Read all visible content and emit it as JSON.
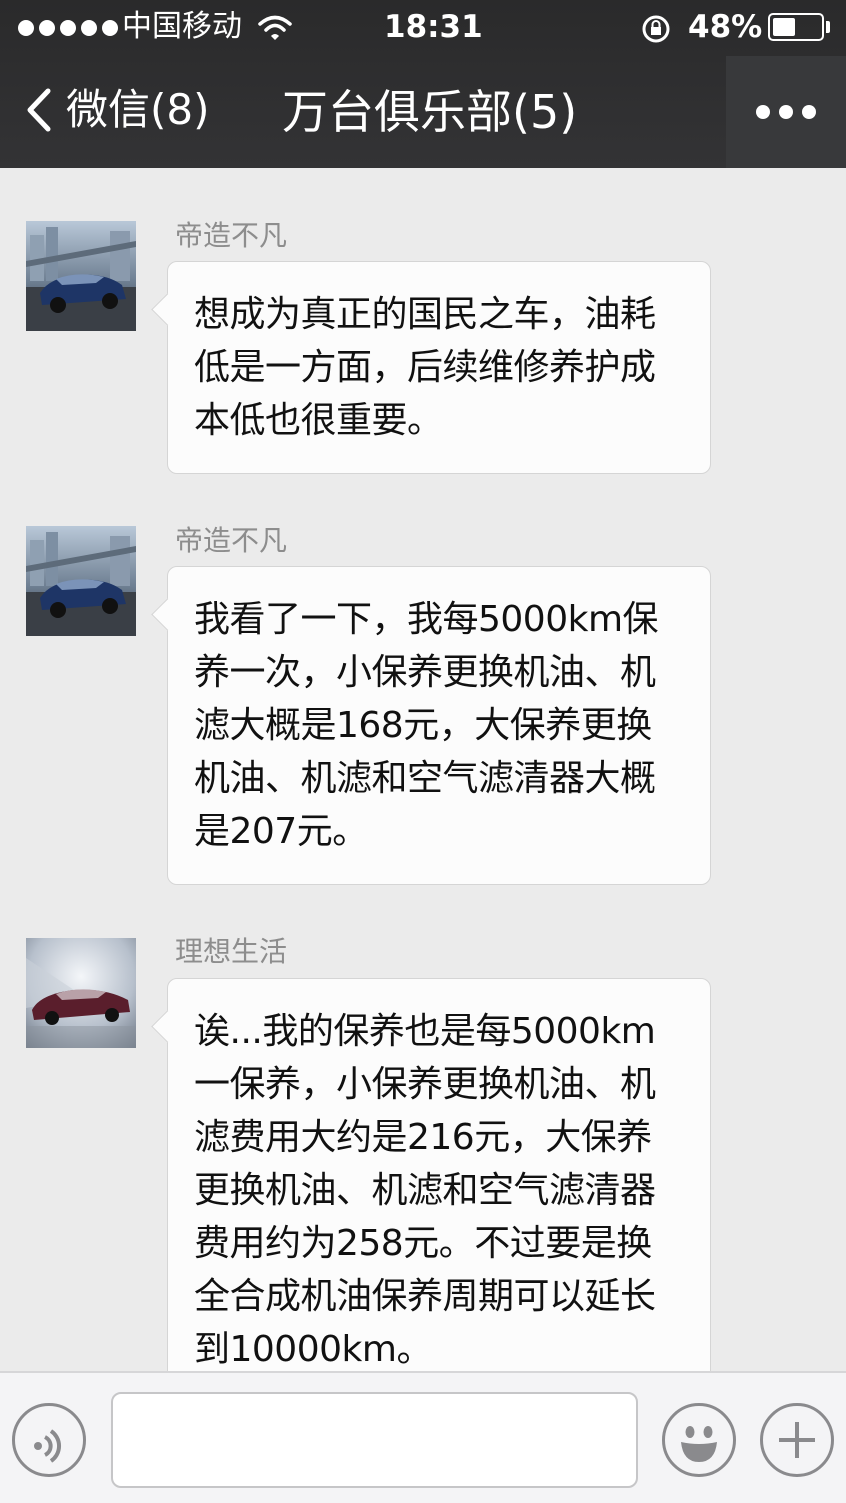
{
  "status_bar": {
    "carrier": "中国移动",
    "time": "18:31",
    "battery_percent": "48%",
    "battery_level": 0.48,
    "signal_dots": 5
  },
  "nav": {
    "back_label": "微信(8)",
    "title": "万台俱乐部(5)"
  },
  "messages": [
    {
      "sender": "帝造不凡",
      "text": "想成为真正的国民之车，油耗低是一方面，后续维修养护成本低也很重要。"
    },
    {
      "sender": "帝造不凡",
      "text": "我看了一下，我每5000km保养一次，小保养更换机油、机滤大概是168元，大保养更换机油、机滤和空气滤清器大概是207元。"
    },
    {
      "sender": "理想生活",
      "text": "诶...我的保养也是每5000km一保养，小保养更换机油、机滤费用大约是216元，大保养更换机油、机滤和空气滤清器费用约为258元。不过要是换全合成机油保养周期可以延长到10000km。"
    }
  ],
  "input": {
    "value": ""
  },
  "icons": {
    "back": "chevron-left-icon",
    "more": "more-dots-icon",
    "voice": "voice-icon",
    "emoji": "emoji-icon",
    "plus": "plus-icon",
    "wifi": "wifi-icon",
    "lock": "rotation-lock-icon"
  },
  "colors": {
    "header": "#2f2f30",
    "chat_background": "#ebebeb",
    "bubble": "#fcfcfc",
    "sender_name": "#8d8d8d"
  }
}
